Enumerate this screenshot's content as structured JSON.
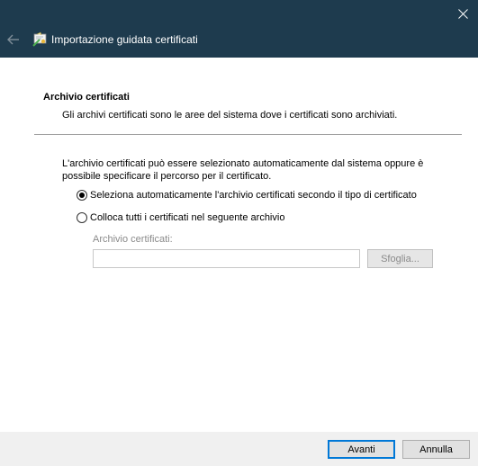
{
  "window": {
    "title": "Importazione guidata certificati",
    "accent_color": "#1e3b4e",
    "close_icon": "close-icon",
    "back_icon": "back-arrow-icon",
    "wizard_icon": "certificate-wizard-icon"
  },
  "header": {
    "section_title": "Archivio certificati",
    "section_description": "Gli archivi certificati sono le aree del sistema dove i certificati sono archiviati."
  },
  "main": {
    "info_text": "L'archivio certificati può essere selezionato automaticamente dal sistema oppure è possibile specificare il percorso per il certificato.",
    "options": [
      {
        "label": "Seleziona automaticamente l'archivio certificati secondo il tipo di certificato",
        "selected": true
      },
      {
        "label": "Colloca tutti i certificati nel seguente archivio",
        "selected": false
      }
    ],
    "store_label": "Archivio certificati:",
    "store_value": "",
    "browse_label": "Sfoglia..."
  },
  "footer": {
    "next_label": "Avanti",
    "cancel_label": "Annulla"
  }
}
